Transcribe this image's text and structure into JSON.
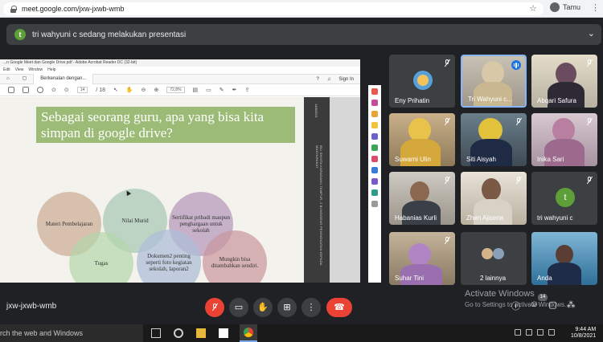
{
  "browser": {
    "url": "meet.google.com/jxw-jxwb-wmb",
    "profile_name": "Tamu"
  },
  "banner": {
    "initial": "t",
    "text": "tri wahyuni c sedang melakukan presentasi"
  },
  "acrobat": {
    "window_title": "...n Google Meet dan Google Drive.pdf - Adobe Acrobat Reader DC (32-bit)",
    "menu": [
      "Edit",
      "View",
      "Window",
      "Help"
    ],
    "tab_label": "Berkenalan dengan...",
    "sign_in": "Sign In",
    "page_current": "14",
    "page_total": "/ 18",
    "zoom": "72,8%"
  },
  "slide": {
    "title": "Sebagai seorang guru, apa yang bisa kita simpan di google drive?",
    "bubbles": [
      "Materi Pembelajaran",
      "Nilai Murid",
      "Tugas",
      "Sertifikat pribadi maupun penghargaan untuk sekolah",
      "Dokumen2 penting seperti foto kegiatan sekolah, laporan2",
      "Mungkin bisa ditambahkan sendiri."
    ],
    "side_note": "IBU SHINTA KARAGAHU TAMPUR, 2 BUNGGENG PENINGKATAN KEPADA MASYARAKAT",
    "side_date": "14/8/2021"
  },
  "participants": [
    {
      "name": "Eny Prihatin"
    },
    {
      "name": "Tri Wahyuni c..."
    },
    {
      "name": "Abqari Safura"
    },
    {
      "name": "Suwarni Ulin"
    },
    {
      "name": "Siti Aisyah"
    },
    {
      "name": "Inika Sari"
    },
    {
      "name": "Habanias Kurli"
    },
    {
      "name": "Zhen Ajisena"
    },
    {
      "name": "tri wahyuni c",
      "initial": "t"
    },
    {
      "name": "Suhar Tini"
    },
    {
      "name": "2 lainnya"
    },
    {
      "name": "Anda"
    }
  ],
  "bottom": {
    "meeting_code": "jxw-jxwb-wmb",
    "activate_title": "Activate Windows",
    "activate_sub": "Go to Settings to activate Windows.",
    "people_count": "14"
  },
  "taskbar": {
    "search_text": "rch the web and Windows",
    "time": "9:44 AM",
    "date": "10/8/2021"
  },
  "colors": {
    "meet_bg": "#202124",
    "tile_bg": "#3c4043",
    "active_border": "#8ab4f8",
    "end_call": "#ea4335",
    "slide_title_bg": "#9bbb77",
    "avatar_green": "#5e9f3a"
  }
}
